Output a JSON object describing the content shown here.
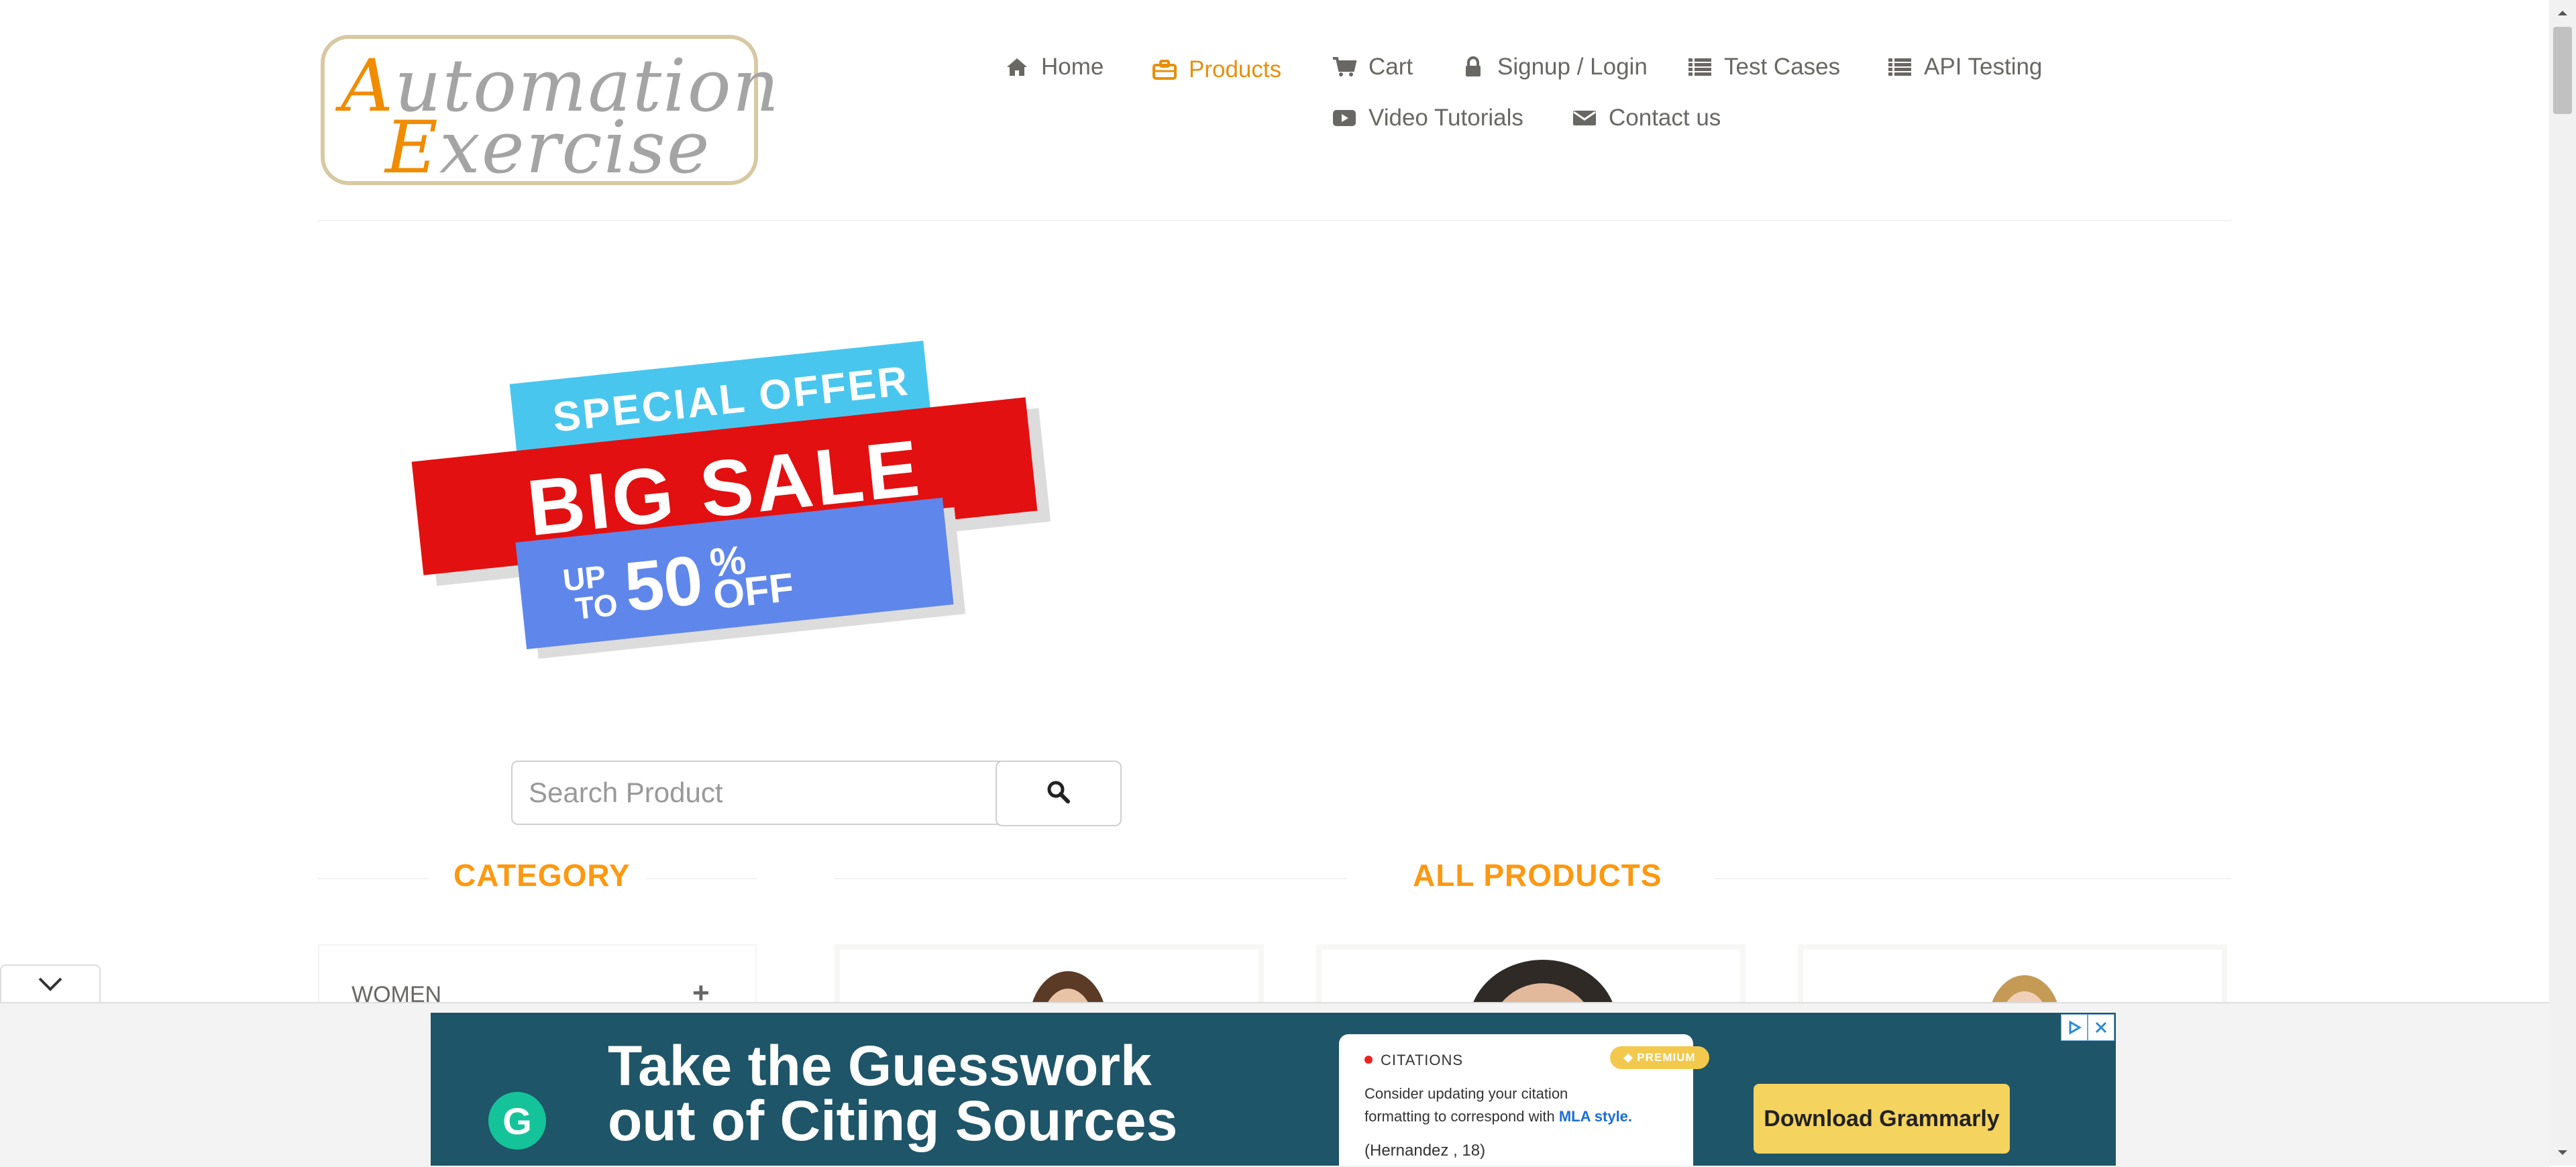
{
  "brand": {
    "line1_cap": "A",
    "line1_rest": "utomation",
    "line2_cap": "E",
    "line2_rest": "xercise"
  },
  "nav": {
    "home": "Home",
    "products": "Products",
    "cart": "Cart",
    "signup_login": "Signup / Login",
    "test_cases": "Test Cases",
    "api_testing": "API Testing",
    "video_tutorials": "Video Tutorials",
    "contact_us": "Contact us"
  },
  "banner": {
    "special_offer": "SPECIAL OFFER",
    "big_sale": "BIG SALE",
    "up": "UP",
    "to": "TO",
    "percent_value": "50",
    "percent_sign": "%",
    "off": "OFF"
  },
  "search": {
    "placeholder": "Search Product"
  },
  "sections": {
    "category": "CATEGORY",
    "all_products": "ALL PRODUCTS"
  },
  "category": {
    "items": [
      {
        "label": "WOMEN"
      }
    ]
  },
  "ad": {
    "headline_line1": "Take the Guesswork",
    "headline_line2": "out of Citing Sources",
    "card_label": "CITATIONS",
    "premium": "PREMIUM",
    "card_text_1": "Consider updating your citation",
    "card_text_2": "formatting to correspond with",
    "card_link": "MLA style.",
    "card_example": "(Hernandez , 18)",
    "cta": "Download Grammarly"
  },
  "colors": {
    "accent": "#fe980f",
    "active_nav": "#e5900c",
    "nav_text": "#696763",
    "ad_bg": "#1e5568",
    "cta_bg": "#f4d35e"
  },
  "icons": {
    "home": "home-icon",
    "products": "briefcase-icon",
    "cart": "cart-icon",
    "signup_login": "lock-icon",
    "test_cases": "list-icon",
    "api_testing": "list-icon",
    "video_tutorials": "play-icon",
    "contact_us": "envelope-icon",
    "search": "search-icon"
  }
}
